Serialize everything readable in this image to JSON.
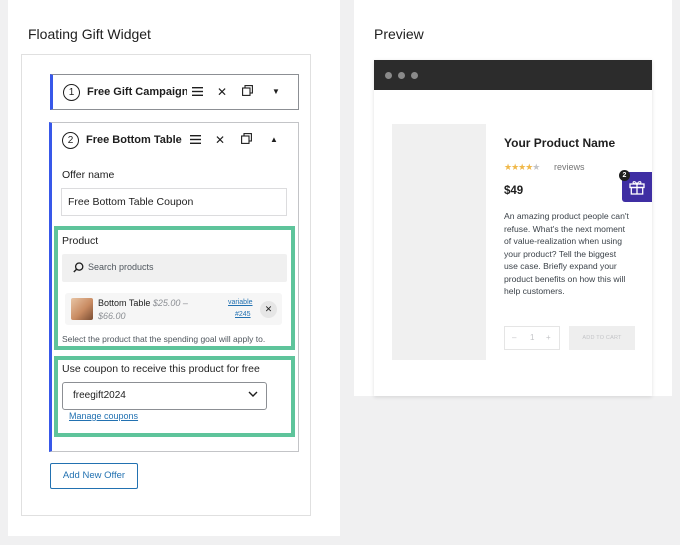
{
  "left": {
    "title": "Floating Gift Widget",
    "offers": [
      {
        "number": "1",
        "name": "Free Gift Campaign"
      },
      {
        "number": "2",
        "name": "Free Bottom Table C"
      }
    ],
    "offer_name_label": "Offer name",
    "offer_name_value": "Free Bottom Table Coupon",
    "product_label": "Product",
    "search_placeholder": "Search products",
    "product_item": {
      "name": "Bottom Table",
      "price_old": "$25.00 –",
      "price_new": "$66.00",
      "type": "variable",
      "id": "#245"
    },
    "product_help": "Select the product that the spending goal will apply to.",
    "coupon_label": "Use coupon to receive this product for free",
    "coupon_value": "freegift2024",
    "manage_coupons": "Manage coupons",
    "add_offer": "Add New Offer"
  },
  "preview": {
    "title": "Preview",
    "product_title": "Your Product Name",
    "rating": 4,
    "reviews_label": "reviews",
    "price": "$49",
    "description": "An amazing product people can't refuse. What's the next moment of value-realization when using your product? Tell the biggest use case. Briefly expand your product benefits on how this will help customers.",
    "qty_minus": "–",
    "qty_value": "1",
    "qty_plus": "+",
    "add_to_cart": "ADD TO CART",
    "gift_count": "2"
  },
  "colors": {
    "accent": "#3858e9",
    "highlight": "#5ec49b",
    "gift_widget": "#3f2ea3",
    "link": "#2271b1"
  }
}
